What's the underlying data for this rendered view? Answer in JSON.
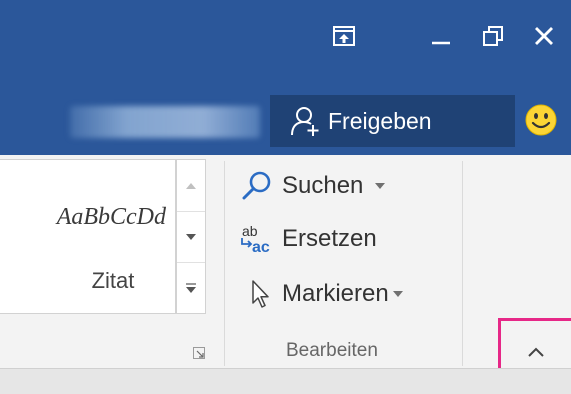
{
  "colors": {
    "titlebar": "#2b579a",
    "share_button": "#1f4275",
    "ribbon": "#f3f3f3",
    "highlight": "#e62787"
  },
  "window_controls": {
    "ribbon_display_options_icon": "ribbon-display-options-icon",
    "minimize_icon": "minimize-icon",
    "restore_icon": "restore-icon",
    "close_icon": "close-icon"
  },
  "header": {
    "share_label": "Freigeben",
    "share_icon": "person-add-icon",
    "feedback_icon": "smiley-icon"
  },
  "styles_gallery": {
    "sample_text": "AaBbCcDd",
    "style_name": "Zitat"
  },
  "editing_group": {
    "label": "Bearbeiten",
    "commands": [
      {
        "label": "Suchen",
        "icon": "search-icon",
        "has_dropdown": true
      },
      {
        "label": "Ersetzen",
        "icon": "replace-icon",
        "has_dropdown": false
      },
      {
        "label": "Markieren",
        "icon": "select-cursor-icon",
        "has_dropdown": true
      }
    ]
  },
  "collapse_ribbon": {
    "icon": "chevron-up-icon"
  }
}
